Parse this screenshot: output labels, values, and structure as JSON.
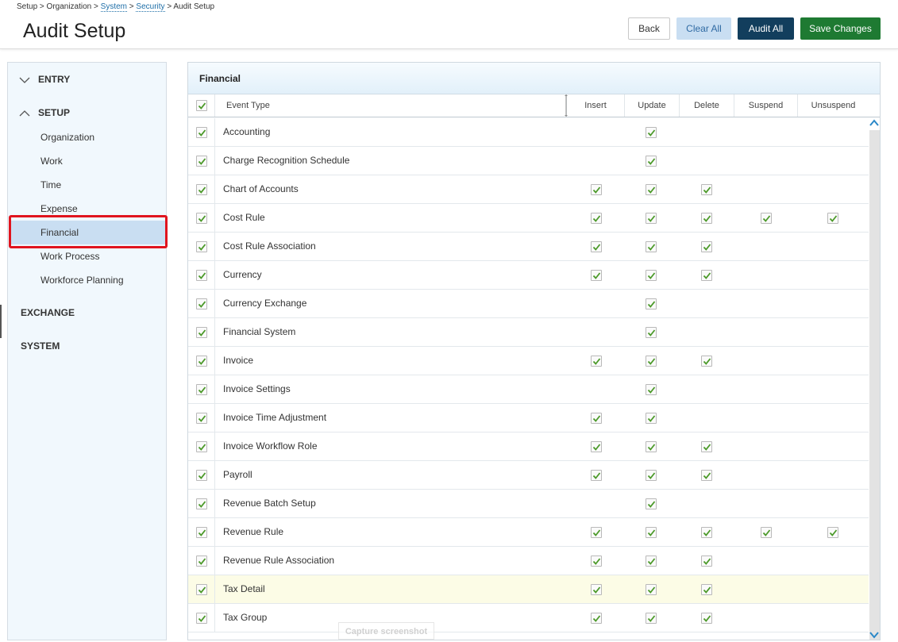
{
  "breadcrumb": {
    "setup": "Setup",
    "organization": "Organization",
    "system": "System",
    "security": "Security",
    "current": "Audit Setup",
    "separator": ">"
  },
  "page": {
    "title": "Audit Setup"
  },
  "toolbar": {
    "back_label": "Back",
    "clear_all_label": "Clear All",
    "audit_all_label": "Audit All",
    "save_label": "Save Changes"
  },
  "sidebar": {
    "sections": [
      {
        "label": "ENTRY",
        "state": "collapsed"
      },
      {
        "label": "SETUP",
        "state": "expanded"
      },
      {
        "label": "EXCHANGE"
      },
      {
        "label": "SYSTEM"
      }
    ],
    "setup_items": [
      "Organization",
      "Work",
      "Time",
      "Expense",
      "Financial",
      "Work Process",
      "Workforce Planning"
    ],
    "active_item": "Financial"
  },
  "panel": {
    "title": "Financial",
    "columns": [
      "Event Type",
      "Insert",
      "Update",
      "Delete",
      "Suspend",
      "Unsuspend"
    ],
    "rows": [
      {
        "name": "Accounting",
        "insert": false,
        "update": true,
        "delete": false,
        "suspend": false,
        "unsuspend": false
      },
      {
        "name": "Charge Recognition Schedule",
        "insert": false,
        "update": true,
        "delete": false,
        "suspend": false,
        "unsuspend": false
      },
      {
        "name": "Chart of Accounts",
        "insert": true,
        "update": true,
        "delete": true,
        "suspend": false,
        "unsuspend": false
      },
      {
        "name": "Cost Rule",
        "insert": true,
        "update": true,
        "delete": true,
        "suspend": true,
        "unsuspend": true
      },
      {
        "name": "Cost Rule Association",
        "insert": true,
        "update": true,
        "delete": true,
        "suspend": false,
        "unsuspend": false
      },
      {
        "name": "Currency",
        "insert": true,
        "update": true,
        "delete": true,
        "suspend": false,
        "unsuspend": false
      },
      {
        "name": "Currency Exchange",
        "insert": false,
        "update": true,
        "delete": false,
        "suspend": false,
        "unsuspend": false
      },
      {
        "name": "Financial System",
        "insert": false,
        "update": true,
        "delete": false,
        "suspend": false,
        "unsuspend": false
      },
      {
        "name": "Invoice",
        "insert": true,
        "update": true,
        "delete": true,
        "suspend": false,
        "unsuspend": false
      },
      {
        "name": "Invoice Settings",
        "insert": false,
        "update": true,
        "delete": false,
        "suspend": false,
        "unsuspend": false
      },
      {
        "name": "Invoice Time Adjustment",
        "insert": true,
        "update": true,
        "delete": false,
        "suspend": false,
        "unsuspend": false
      },
      {
        "name": "Invoice Workflow Role",
        "insert": true,
        "update": true,
        "delete": true,
        "suspend": false,
        "unsuspend": false
      },
      {
        "name": "Payroll",
        "insert": true,
        "update": true,
        "delete": true,
        "suspend": false,
        "unsuspend": false
      },
      {
        "name": "Revenue Batch Setup",
        "insert": false,
        "update": true,
        "delete": false,
        "suspend": false,
        "unsuspend": false
      },
      {
        "name": "Revenue Rule",
        "insert": true,
        "update": true,
        "delete": true,
        "suspend": true,
        "unsuspend": true
      },
      {
        "name": "Revenue Rule Association",
        "insert": true,
        "update": true,
        "delete": true,
        "suspend": false,
        "unsuspend": false
      },
      {
        "name": "Tax Detail",
        "insert": true,
        "update": true,
        "delete": true,
        "suspend": false,
        "unsuspend": false,
        "highlighted": true
      },
      {
        "name": "Tax Group",
        "insert": true,
        "update": true,
        "delete": true,
        "suspend": false,
        "unsuspend": false
      }
    ]
  },
  "overlay": {
    "capture_label": "Capture screenshot"
  },
  "icons": {
    "check": "check-icon",
    "chevron_down": "chevron-down-icon",
    "chevron_up": "chevron-up-icon",
    "column_resize": "column-resize-icon"
  },
  "colors": {
    "check_green": "#4c9a2a",
    "audit_all_bg": "#123e5d",
    "save_bg": "#1e7a32",
    "clear_all_bg": "#c9def2",
    "highlight_red": "#e0141e",
    "sidebar_bg": "#f1f8fd",
    "active_item_bg": "#c9def2",
    "highlighted_row_bg": "#fcfce6"
  }
}
